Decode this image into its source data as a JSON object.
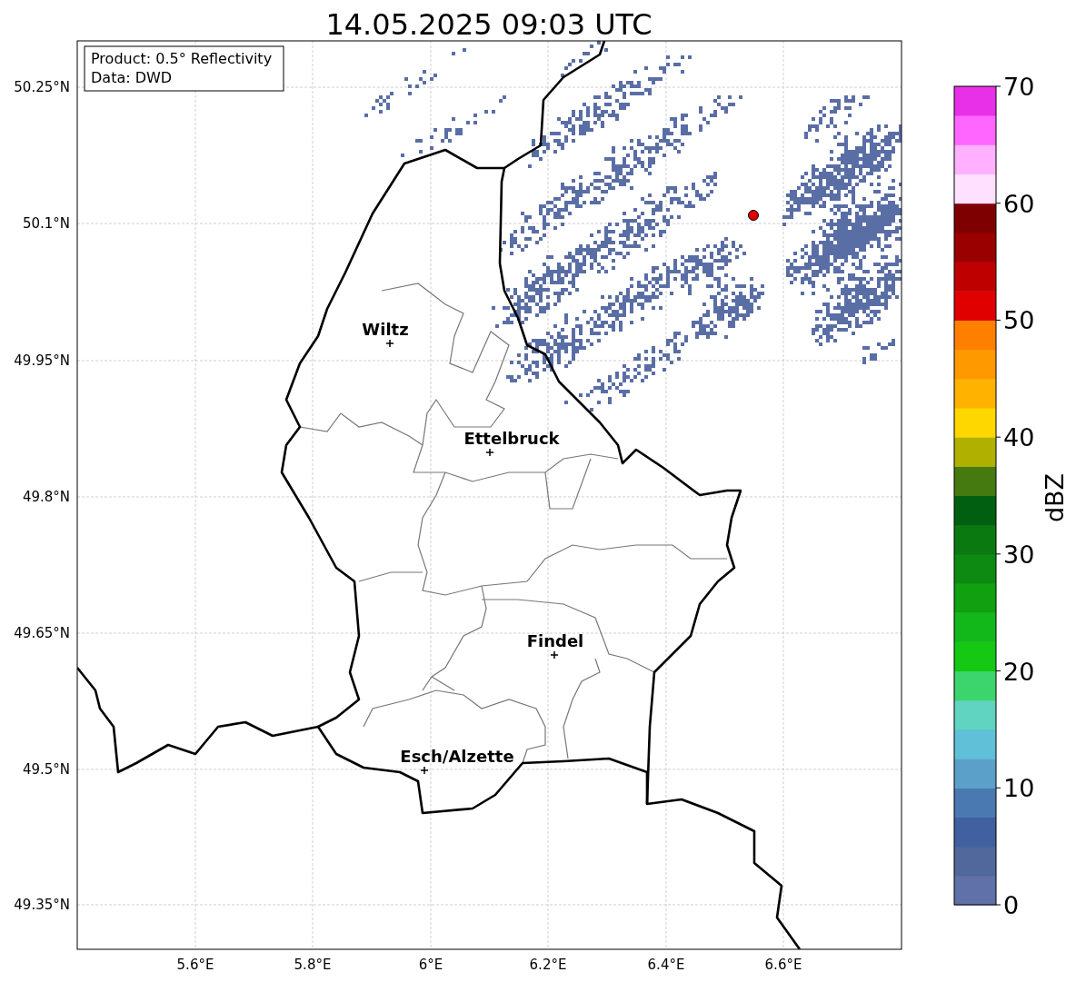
{
  "title": "14.05.2025 09:03 UTC",
  "info_box": {
    "lines": [
      "Product: 0.5° Reflectivity",
      "Data: DWD"
    ]
  },
  "map": {
    "yticks": [
      "50.25°N",
      "50.1°N",
      "49.95°N",
      "49.8°N",
      "49.65°N",
      "49.5°N",
      "49.35°N"
    ],
    "xticks": [
      "5.6°E",
      "5.8°E",
      "6°E",
      "6.2°E",
      "6.4°E",
      "6.6°E"
    ],
    "cities": [
      {
        "name": "Wiltz"
      },
      {
        "name": "Ettelbruck"
      },
      {
        "name": "Findel"
      },
      {
        "name": "Esch/Alzette"
      }
    ]
  },
  "colorbar": {
    "label": "dBZ",
    "ticks": [
      "70",
      "60",
      "50",
      "40",
      "30",
      "20",
      "10",
      "0"
    ],
    "bins": [
      {
        "color": "#6070a8"
      },
      {
        "color": "#50689c"
      },
      {
        "color": "#4060a0"
      },
      {
        "color": "#4a78b0"
      },
      {
        "color": "#5aa0c8"
      },
      {
        "color": "#60c0d8"
      },
      {
        "color": "#60d4c0"
      },
      {
        "color": "#3cd46c"
      },
      {
        "color": "#14c814"
      },
      {
        "color": "#12b81a"
      },
      {
        "color": "#10a010"
      },
      {
        "color": "#0c8a12"
      },
      {
        "color": "#0a7a10"
      },
      {
        "color": "#005f10"
      },
      {
        "color": "#447a10"
      },
      {
        "color": "#b0b000"
      },
      {
        "color": "#ffd700"
      },
      {
        "color": "#ffb300"
      },
      {
        "color": "#ff9900"
      },
      {
        "color": "#ff7f00"
      },
      {
        "color": "#e00000"
      },
      {
        "color": "#bf0000"
      },
      {
        "color": "#9a0000"
      },
      {
        "color": "#7f0000"
      },
      {
        "color": "#ffe0ff"
      },
      {
        "color": "#ffb0ff"
      },
      {
        "color": "#ff66ff"
      },
      {
        "color": "#e930e9"
      }
    ]
  }
}
